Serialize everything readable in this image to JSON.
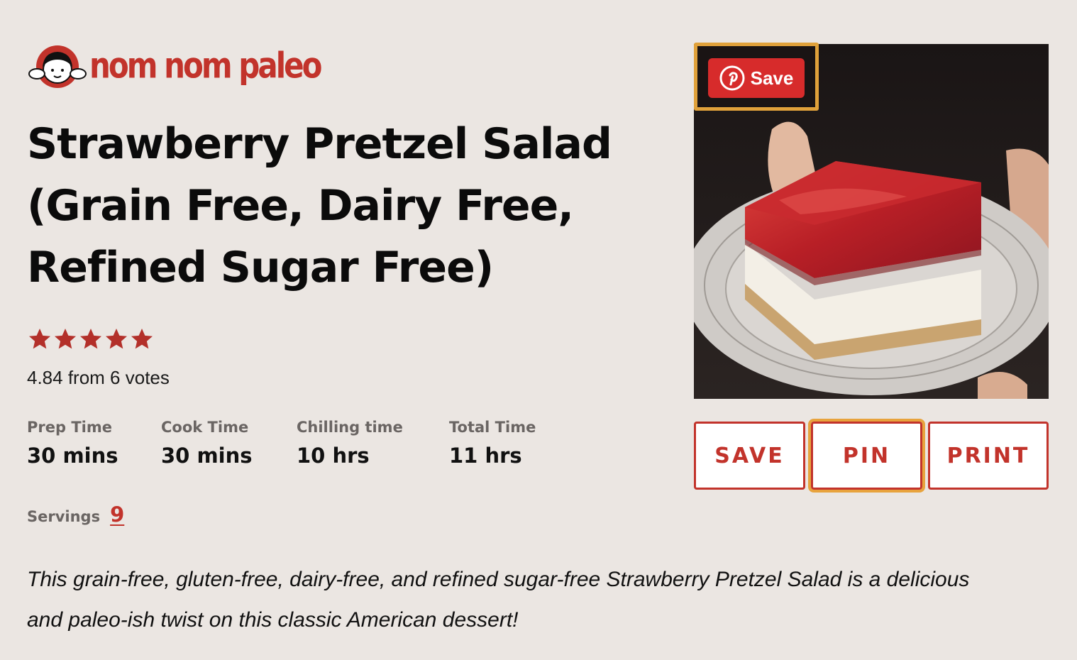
{
  "brand": {
    "name": "nom nom paleo",
    "accent": "#c2332b",
    "logo_icon": "girl-face-logo-icon"
  },
  "recipe": {
    "title": "Strawberry Pretzel Salad (Grain Free, Dairy Free, Refined Sugar Free)",
    "rating": {
      "value": 4.84,
      "max": 5,
      "text": "4.84 from 6 votes",
      "star_color": "#b3302a"
    },
    "times": [
      {
        "label": "Prep Time",
        "value": "30 mins"
      },
      {
        "label": "Cook Time",
        "value": "30 mins"
      },
      {
        "label": "Chilling time",
        "value": "10 hrs"
      },
      {
        "label": "Total Time",
        "value": "11 hrs"
      }
    ],
    "servings": {
      "label": "Servings",
      "value": "9"
    },
    "description": "This grain-free, gluten-free, dairy-free, and refined sugar-free Strawberry Pretzel Salad is a delicious and paleo-ish twist on this classic American dessert!"
  },
  "photo": {
    "pinterest_save": {
      "label": "Save",
      "icon": "pinterest-icon",
      "color": "#d72b2b"
    }
  },
  "actions": {
    "save_label": "SAVE",
    "pin_label": "PIN",
    "print_label": "PRINT"
  }
}
